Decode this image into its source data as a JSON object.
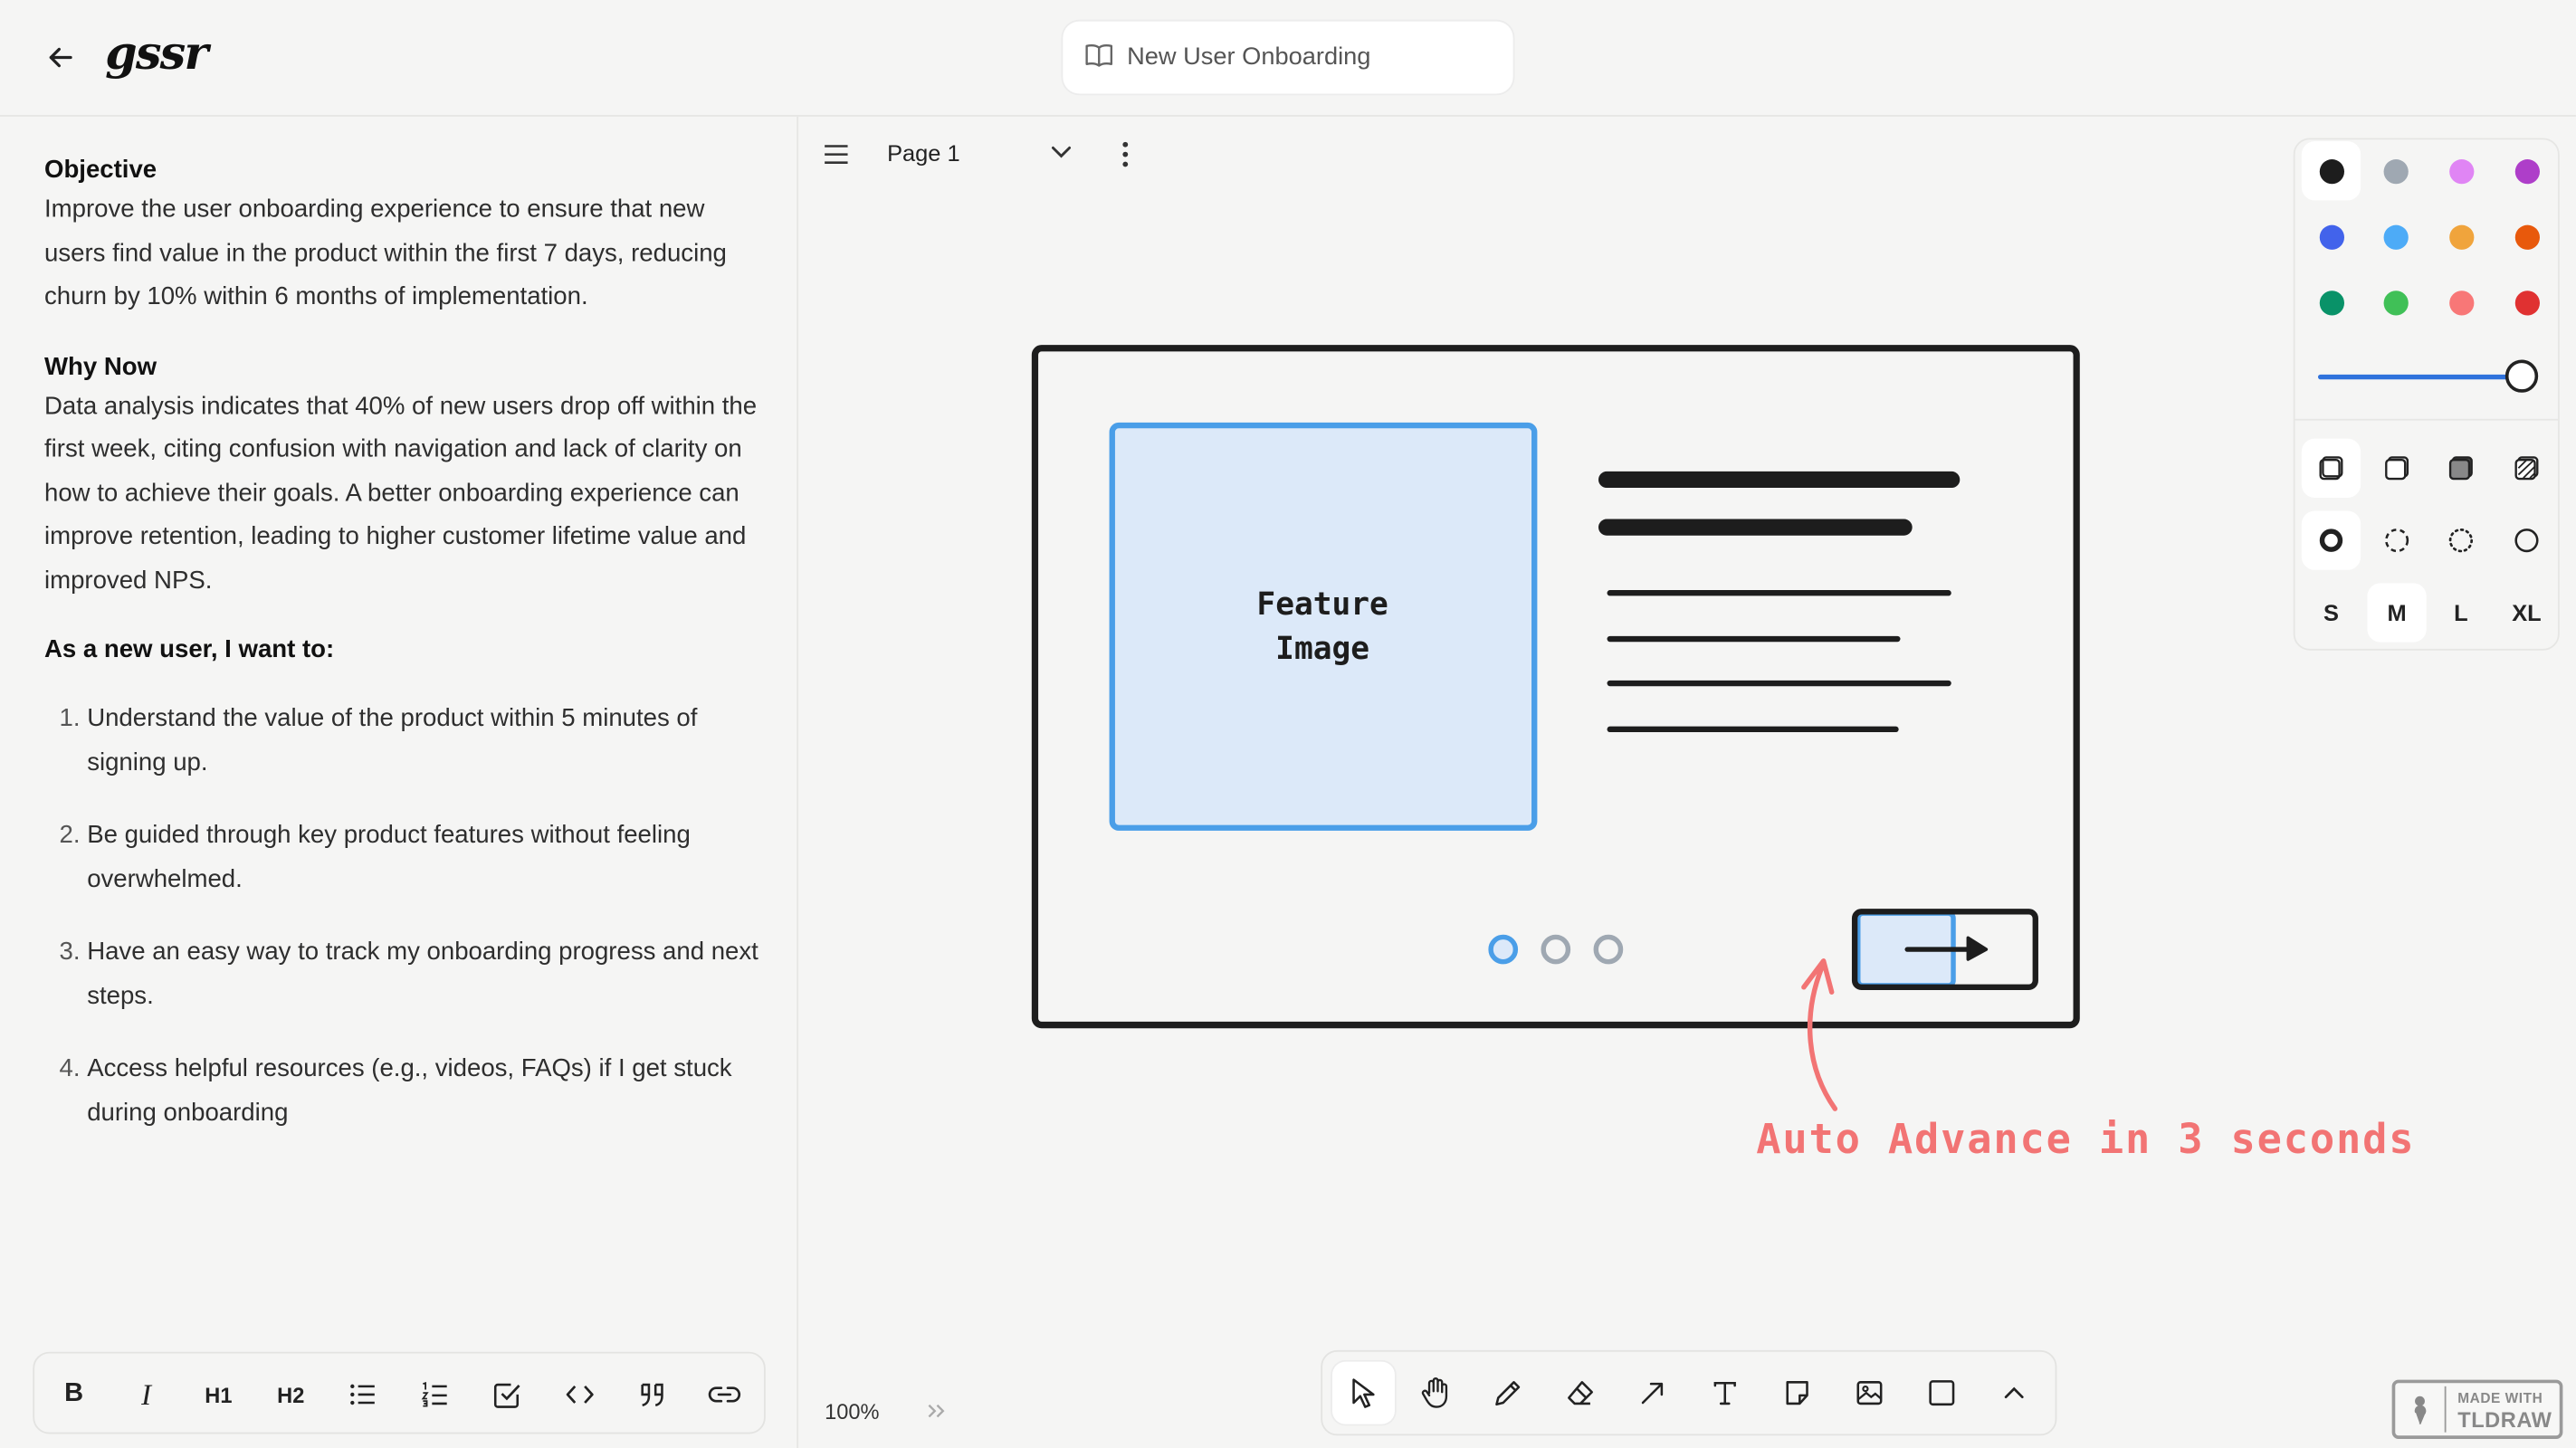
{
  "app": {
    "logo_text": "gssr"
  },
  "header": {
    "doc_title": "New User Onboarding"
  },
  "editor": {
    "objective_heading": "Objective",
    "objective_text": "Improve the user onboarding experience to ensure that new users find value in the product within the first 7 days, reducing churn by 10% within 6 months of implementation.",
    "why_now_heading": "Why Now",
    "why_now_text": "Data analysis indicates that 40% of new users drop off within the first week, citing confusion with navigation and lack of clarity on how to achieve their goals. A better onboarding experience can improve retention, leading to higher customer lifetime value and improved NPS.",
    "user_story_heading": "As a new user, I want to:",
    "user_story_items": [
      "Understand the value of the product within 5 minutes of signing up.",
      "Be guided through key product features without feeling overwhelmed.",
      "Have an easy way to track my onboarding progress and next steps.",
      "Access helpful resources (e.g., videos, FAQs) if I get stuck during onboarding"
    ]
  },
  "format_bar": {
    "bold": "B",
    "italic": "I",
    "h1": "H1",
    "h2": "H2"
  },
  "canvas": {
    "page_name": "Page 1",
    "zoom": "100%",
    "feature_image_line1": "Feature",
    "feature_image_line2": "Image",
    "annotation": "Auto Advance in 3 seconds",
    "carousel_dots": 3,
    "active_dot": 1
  },
  "style_panel": {
    "colors": [
      "#1d1d1d",
      "#9fa8b2",
      "#e085f4",
      "#ae3ec9",
      "#4263eb",
      "#4dabf7",
      "#f0a43c",
      "#e8590c",
      "#099268",
      "#40c057",
      "#f87777",
      "#e03131"
    ],
    "selected_color": "#1d1d1d",
    "opacity": 1.0,
    "sizes": [
      "S",
      "M",
      "L",
      "XL"
    ],
    "selected_size": "M"
  },
  "watermark": {
    "line1": "MADE WITH",
    "line2": "TLDRAW"
  },
  "theme": {
    "accent": "#4a9ee8",
    "annotation_color": "#f27474",
    "feature_fill": "#dce9f9"
  }
}
